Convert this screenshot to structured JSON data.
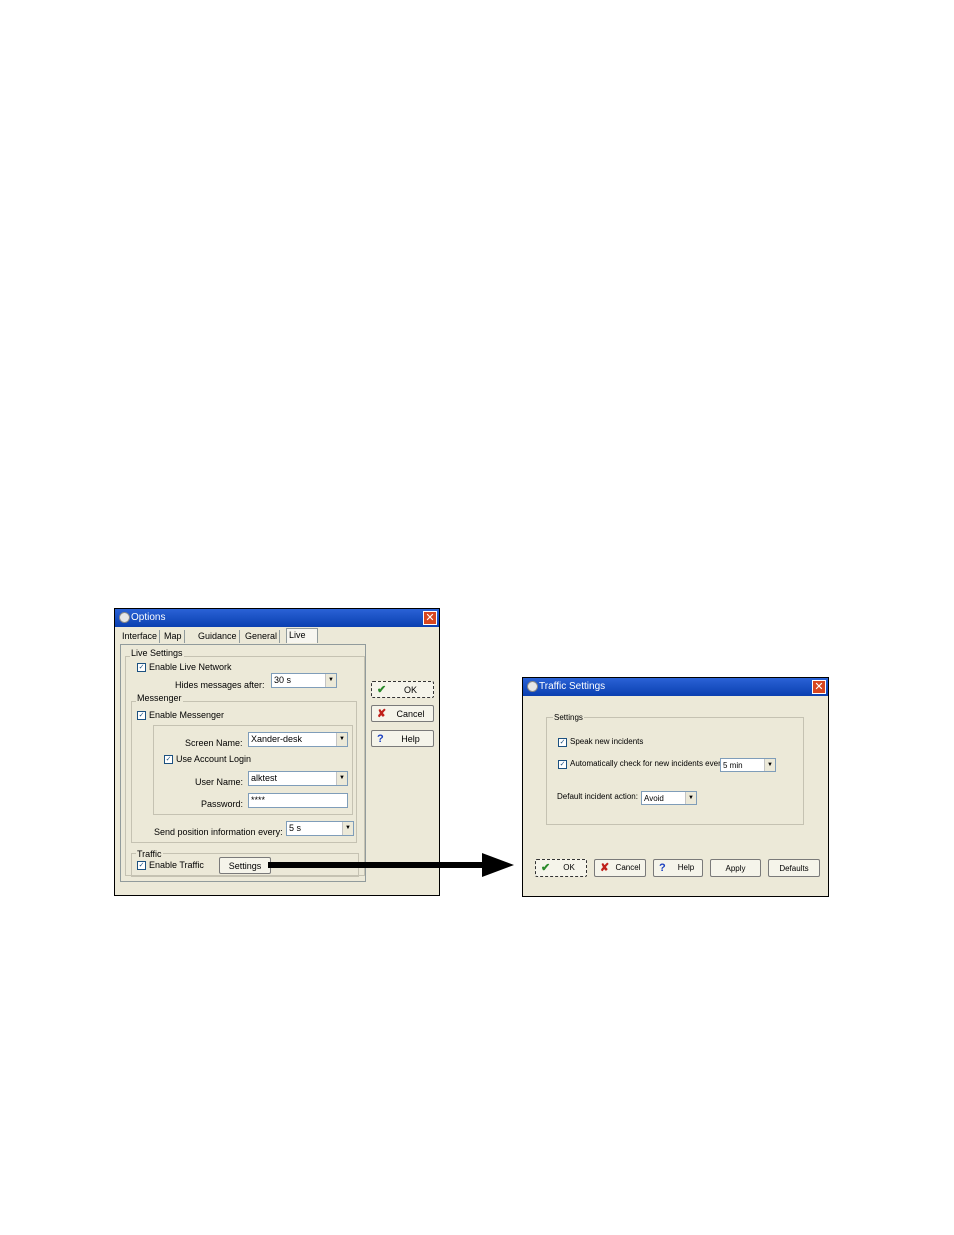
{
  "options_dialog": {
    "title": "Options",
    "close_glyph": "✕",
    "tabs": [
      "Interface",
      "Map",
      "Guidance",
      "General",
      "Live"
    ],
    "active_tab": "Live",
    "live_settings": {
      "group_label": "Live Settings",
      "enable_live_network": {
        "label": "Enable Live Network",
        "checked": true
      },
      "hides_messages_label": "Hides messages after:",
      "hides_messages_value": "30 s"
    },
    "messenger": {
      "group_label": "Messenger",
      "enable_messenger": {
        "label": "Enable Messenger",
        "checked": true
      },
      "screen_name_label": "Screen Name:",
      "screen_name_value": "Xander-desk",
      "use_account_login": {
        "label": "Use Account Login",
        "checked": true
      },
      "user_name_label": "User Name:",
      "user_name_value": "alktest",
      "password_label": "Password:",
      "password_value": "****",
      "send_position_label": "Send position information every:",
      "send_position_value": "5 s"
    },
    "traffic": {
      "group_label": "Traffic",
      "enable_traffic": {
        "label": "Enable Traffic",
        "checked": true
      },
      "settings_button": "Settings"
    },
    "buttons": {
      "ok": "OK",
      "cancel": "Cancel",
      "help": "Help"
    }
  },
  "traffic_dialog": {
    "title": "Traffic Settings",
    "close_glyph": "✕",
    "settings_group_label": "Settings",
    "speak_new_incidents": {
      "label": "Speak new incidents",
      "checked": true
    },
    "auto_check": {
      "label": "Automatically check for new incidents every",
      "checked": true
    },
    "auto_check_value": "5 min",
    "default_action_label": "Default incident action:",
    "default_action_value": "Avoid",
    "buttons": {
      "ok": "OK",
      "cancel": "Cancel",
      "help": "Help",
      "apply": "Apply",
      "defaults": "Defaults"
    }
  },
  "icons": {
    "check": "✔",
    "cross": "✘",
    "question": "?",
    "checkmark": "✓",
    "dropdown": "▼"
  },
  "colors": {
    "title_bar": "#0a3fb0",
    "dialog_bg": "#ece9d8",
    "close_button": "#d8461f",
    "ok_icon": "#2a8a2a",
    "cancel_icon": "#c0201a",
    "help_icon": "#1a3fc0"
  }
}
